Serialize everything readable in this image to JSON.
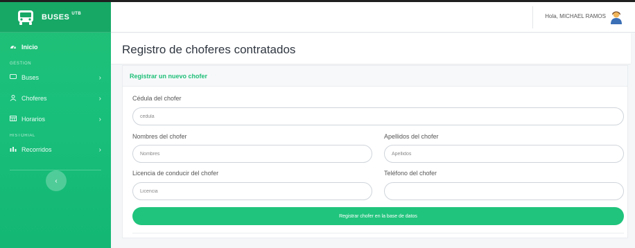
{
  "brand": {
    "name": "BUSES",
    "suffix": "UTB"
  },
  "topbar": {
    "greeting": "Hola, MICHAEL RAMOS"
  },
  "sidebar": {
    "inicio": "Inicio",
    "section_gestion": "GESTIÓN",
    "items_gestion": [
      {
        "label": "Buses",
        "icon": "bus-icon"
      },
      {
        "label": "Choferes",
        "icon": "user-icon"
      },
      {
        "label": "Horarios",
        "icon": "calendar-icon"
      }
    ],
    "section_historial": "HISTORIAL",
    "items_historial": [
      {
        "label": "Recorridos",
        "icon": "chart-icon"
      }
    ],
    "collapse_glyph": "‹"
  },
  "page": {
    "title": "Registro de choferes contratados"
  },
  "form": {
    "header": "Registrar un nuevo chofer",
    "cedula": {
      "label": "Cédula del chofer",
      "placeholder": "cedula"
    },
    "nombres": {
      "label": "Nombres del chofer",
      "placeholder": "Nombres"
    },
    "apellidos": {
      "label": "Apellidos del chofer",
      "placeholder": "Apellidos"
    },
    "licencia": {
      "label": "Licencia de conducir del chofer",
      "placeholder": "Licencia"
    },
    "telefono": {
      "label": "Teléfono del chofer",
      "placeholder": ""
    },
    "submit": "Registrar chofer en la base de datos"
  },
  "colors": {
    "accent": "#1fbf78",
    "sidebar": "#19c07b",
    "button": "#20c47c"
  }
}
